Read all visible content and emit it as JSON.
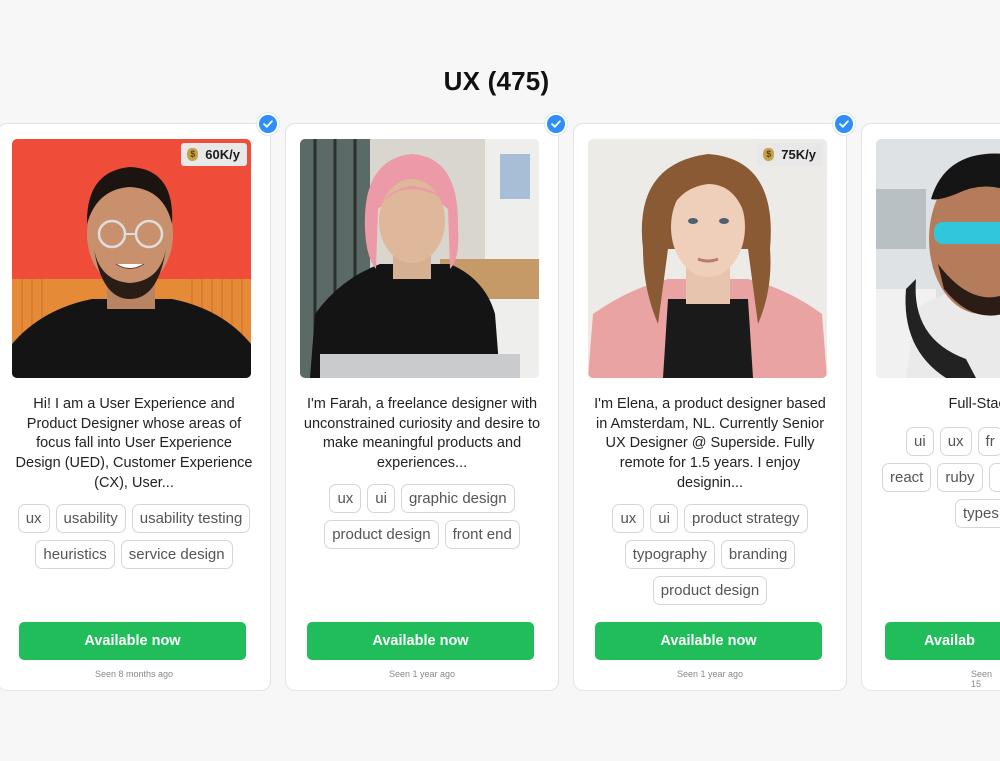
{
  "section": {
    "title": "UX (475)"
  },
  "colors": {
    "accent_green": "#21bd5b",
    "verified_blue": "#2f8ef6"
  },
  "cards": [
    {
      "salary": "60K/y",
      "bio": "Hi! I am a User Experience and Product Designer whose areas of focus fall into User Experience Design (UED), Customer Experience (CX), User...",
      "tags": [
        "ux",
        "usability",
        "usability testing",
        "heuristics",
        "service design"
      ],
      "cta": "Available now",
      "seen": "Seen 8 months ago"
    },
    {
      "salary": "",
      "bio": "I'm Farah, a freelance designer with unconstrained curiosity and desire to make meaningful products and experiences...",
      "tags": [
        "ux",
        "ui",
        "graphic design",
        "product design",
        "front end"
      ],
      "cta": "Available now",
      "seen": "Seen 1 year ago"
    },
    {
      "salary": "75K/y",
      "bio": "I'm Elena, a product designer based in Amsterdam, NL. Currently Senior UX Designer @ Superside. Fully remote for 1.5 years. I enjoy designin...",
      "tags": [
        "ux",
        "ui",
        "product strategy",
        "typography",
        "branding",
        "product design"
      ],
      "cta": "Available now",
      "seen": "Seen 1 year ago"
    },
    {
      "salary": "",
      "bio": "Full-Stack / U",
      "tags": [
        "ui",
        "ux",
        "fr",
        "react",
        "ruby",
        "",
        "types"
      ],
      "cta": "Availab",
      "seen": "Seen 15"
    }
  ]
}
